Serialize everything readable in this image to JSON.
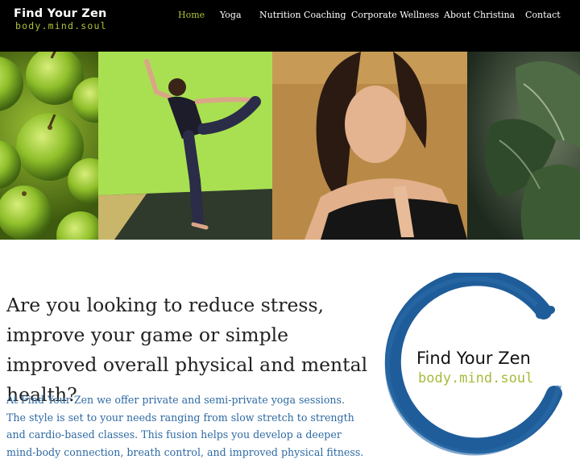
{
  "header": {
    "logo_title": "Find Your Zen",
    "logo_tagline": "body.mind.soul",
    "nav": [
      {
        "label": "Home",
        "active": true
      },
      {
        "label": "Yoga",
        "active": false
      },
      {
        "label": "Nutrition Coaching",
        "active": false
      },
      {
        "label": "Corporate Wellness",
        "active": false
      },
      {
        "label": "About Christina",
        "active": false
      },
      {
        "label": "Contact",
        "active": false
      }
    ]
  },
  "hero": {
    "panels": [
      "green-apples-photo",
      "yoga-dancer-pose-photo",
      "meditation-prayer-hands-photo",
      "kale-leaves-photo"
    ]
  },
  "main": {
    "headline": "Are you looking to reduce stress, improve your game or simple improved overall physical and mental health?",
    "intro": "At Find Your Zen we offer private and semi-private yoga sessions. The style is set to your needs ranging from slow stretch to strength and cardio-based classes. This fusion helps you develop a deeper mind-body connection, breath control, and improved physical fitness."
  },
  "circle_logo": {
    "title": "Find Your Zen",
    "tagline": "body.mind.soul"
  },
  "colors": {
    "accent_green": "#b3c23a",
    "text_blue": "#2e6aa4",
    "circle_blue": "#1f5d9a",
    "header_bg": "#000000"
  }
}
